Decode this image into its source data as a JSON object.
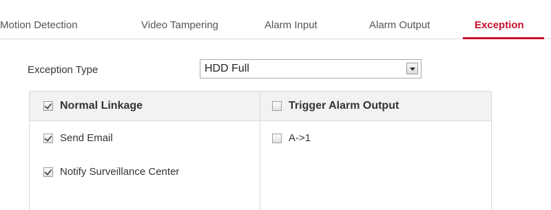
{
  "tabs": [
    {
      "label": "Motion Detection",
      "active": false
    },
    {
      "label": "Video Tampering",
      "active": false
    },
    {
      "label": "Alarm Input",
      "active": false
    },
    {
      "label": "Alarm Output",
      "active": false
    },
    {
      "label": "Exception",
      "active": true
    }
  ],
  "exception_type": {
    "label": "Exception Type",
    "value": "HDD Full"
  },
  "linkage": {
    "normal": {
      "header": {
        "label": "Normal Linkage",
        "checked": true
      },
      "items": [
        {
          "label": "Send Email",
          "checked": true
        },
        {
          "label": "Notify Surveillance Center",
          "checked": true
        }
      ]
    },
    "trigger": {
      "header": {
        "label": "Trigger Alarm Output",
        "checked": false
      },
      "items": [
        {
          "label": "A->1",
          "checked": false
        }
      ]
    }
  },
  "colors": {
    "accent": "#c8102e",
    "border": "#d9d9d9",
    "header_bg": "#f2f2f2"
  }
}
